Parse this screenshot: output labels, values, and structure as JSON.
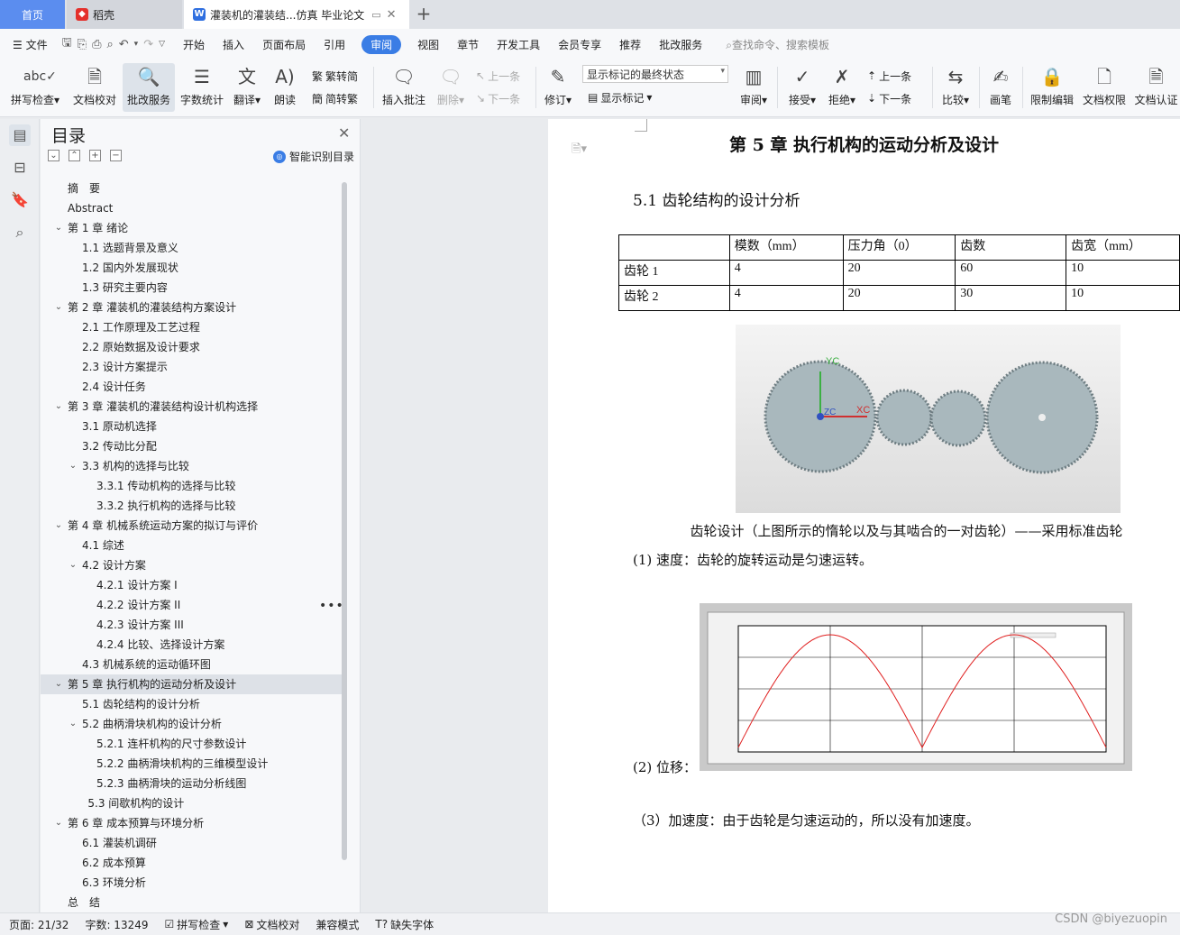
{
  "tabs": {
    "home": "首页",
    "docer": "稻壳",
    "doc": "灌装机的灌装结...仿真 毕业论文"
  },
  "menu": [
    "文件",
    "开始",
    "插入",
    "页面布局",
    "引用",
    "审阅",
    "视图",
    "章节",
    "开发工具",
    "会员专享",
    "推荐",
    "批改服务"
  ],
  "menu_active": "审阅",
  "search_cmd": "查找命令、搜索模板",
  "ribbon": {
    "spell": "拼写检查",
    "proof": "文档校对",
    "review_service": "批改服务",
    "word_count": "字数统计",
    "translate": "翻译",
    "read_aloud": "朗读",
    "trad": "繁转简",
    "simp": "简转繁",
    "insert_comment": "插入批注",
    "delete": "删除",
    "prev": "上一条",
    "next": "下一条",
    "track": "修订",
    "mark_state": "显示标记的最终状态",
    "show_marks": "显示标记",
    "review": "审阅",
    "accept": "接受",
    "reject": "拒绝",
    "prev2": "上一条",
    "next2": "下一条",
    "compare": "比较",
    "pen": "画笔",
    "restrict": "限制编辑",
    "doc_perm": "文档权限",
    "doc_auth": "文档认证"
  },
  "toc": {
    "title": "目录",
    "smart": "智能识别目录",
    "items": [
      {
        "text": "摘　要",
        "level": 0,
        "arrow": ""
      },
      {
        "text": "Abstract",
        "level": 0,
        "arrow": ""
      },
      {
        "text": "第 1 章  绪论",
        "level": 0,
        "arrow": "v"
      },
      {
        "text": "1.1 选题背景及意义",
        "level": 1,
        "arrow": ""
      },
      {
        "text": "1.2 国内外发展现状",
        "level": 1,
        "arrow": ""
      },
      {
        "text": "1.3 研究主要内容",
        "level": 1,
        "arrow": ""
      },
      {
        "text": "第 2 章  灌装机的灌装结构方案设计",
        "level": 0,
        "arrow": "v"
      },
      {
        "text": "2.1 工作原理及工艺过程",
        "level": 1,
        "arrow": ""
      },
      {
        "text": "2.2 原始数据及设计要求",
        "level": 1,
        "arrow": ""
      },
      {
        "text": "2.3 设计方案提示",
        "level": 1,
        "arrow": ""
      },
      {
        "text": "2.4 设计任务",
        "level": 1,
        "arrow": ""
      },
      {
        "text": "第 3 章  灌装机的灌装结构设计机构选择",
        "level": 0,
        "arrow": "v"
      },
      {
        "text": "3.1 原动机选择",
        "level": 1,
        "arrow": ""
      },
      {
        "text": "3.2 传动比分配",
        "level": 1,
        "arrow": ""
      },
      {
        "text": "3.3 机构的选择与比较",
        "level": 1,
        "arrow": "v"
      },
      {
        "text": "3.3.1 传动机构的选择与比较",
        "level": 2,
        "arrow": ""
      },
      {
        "text": "3.3.2 执行机构的选择与比较",
        "level": 2,
        "arrow": ""
      },
      {
        "text": "第 4 章  机械系统运动方案的拟订与评价",
        "level": 0,
        "arrow": "v"
      },
      {
        "text": "4.1 综述",
        "level": 1,
        "arrow": ""
      },
      {
        "text": "4.2 设计方案",
        "level": 1,
        "arrow": "v"
      },
      {
        "text": "4.2.1  设计方案 I",
        "level": 2,
        "arrow": ""
      },
      {
        "text": "4.2.2  设计方案 II",
        "level": 2,
        "arrow": ""
      },
      {
        "text": "4.2.3  设计方案 III",
        "level": 2,
        "arrow": ""
      },
      {
        "text": "4.2.4 比较、选择设计方案",
        "level": 2,
        "arrow": ""
      },
      {
        "text": "4.3 机械系统的运动循环图",
        "level": 1,
        "arrow": ""
      },
      {
        "text": "第 5 章  执行机构的运动分析及设计",
        "level": 0,
        "arrow": "v",
        "hl": true
      },
      {
        "text": "5.1 齿轮结构的设计分析",
        "level": 1,
        "arrow": ""
      },
      {
        "text": "5.2 曲柄滑块机构的设计分析",
        "level": 1,
        "arrow": "v"
      },
      {
        "text": "5.2.1 连杆机构的尺寸参数设计",
        "level": 2,
        "arrow": ""
      },
      {
        "text": "5.2.2 曲柄滑块机构的三维模型设计",
        "level": 2,
        "arrow": ""
      },
      {
        "text": "5.2.3  曲柄滑块的运动分析线图",
        "level": 2,
        "arrow": ""
      },
      {
        "text": "5.3  间歇机构的设计",
        "level": 1.4,
        "arrow": ""
      },
      {
        "text": "第 6 章  成本预算与环境分析",
        "level": 0,
        "arrow": "v"
      },
      {
        "text": "6.1  灌装机调研",
        "level": 1,
        "arrow": ""
      },
      {
        "text": "6.2  成本预算",
        "level": 1,
        "arrow": ""
      },
      {
        "text": "6.3  环境分析",
        "level": 1,
        "arrow": ""
      },
      {
        "text": "总　结",
        "level": 0,
        "arrow": ""
      }
    ]
  },
  "doc": {
    "chapter": "第 5 章  执行机构的运动分析及设计",
    "section": "5.1 齿轮结构的设计分析",
    "table": {
      "headers": [
        "",
        "模数（mm）",
        "压力角（0）",
        "齿数",
        "齿宽（mm）"
      ],
      "rows": [
        [
          "齿轮 1",
          "4",
          "20",
          "60",
          "10"
        ],
        [
          "齿轮 2",
          "4",
          "20",
          "30",
          "10"
        ]
      ]
    },
    "caption": "齿轮设计（上图所示的惰轮以及与其啮合的一对齿轮）——采用标准齿轮",
    "p1": "(1)  速度：齿轮的旋转运动是匀速运转。",
    "p2": "(2)  位移：",
    "p3": "（3）加速度：由于齿轮是匀速运动的，所以没有加速度。",
    "gear_labels": {
      "y": "YC",
      "x": "XC",
      "z": "ZC"
    }
  },
  "status": {
    "page": "页面: 21/32",
    "words": "字数: 13249",
    "spell": "拼写检查",
    "proof": "文档校对",
    "compat": "兼容模式",
    "missing_font": "缺失字体"
  },
  "watermark": "CSDN @biyezuopin",
  "colors": {
    "accent": "#3a7de5",
    "curve": "#e02020"
  }
}
